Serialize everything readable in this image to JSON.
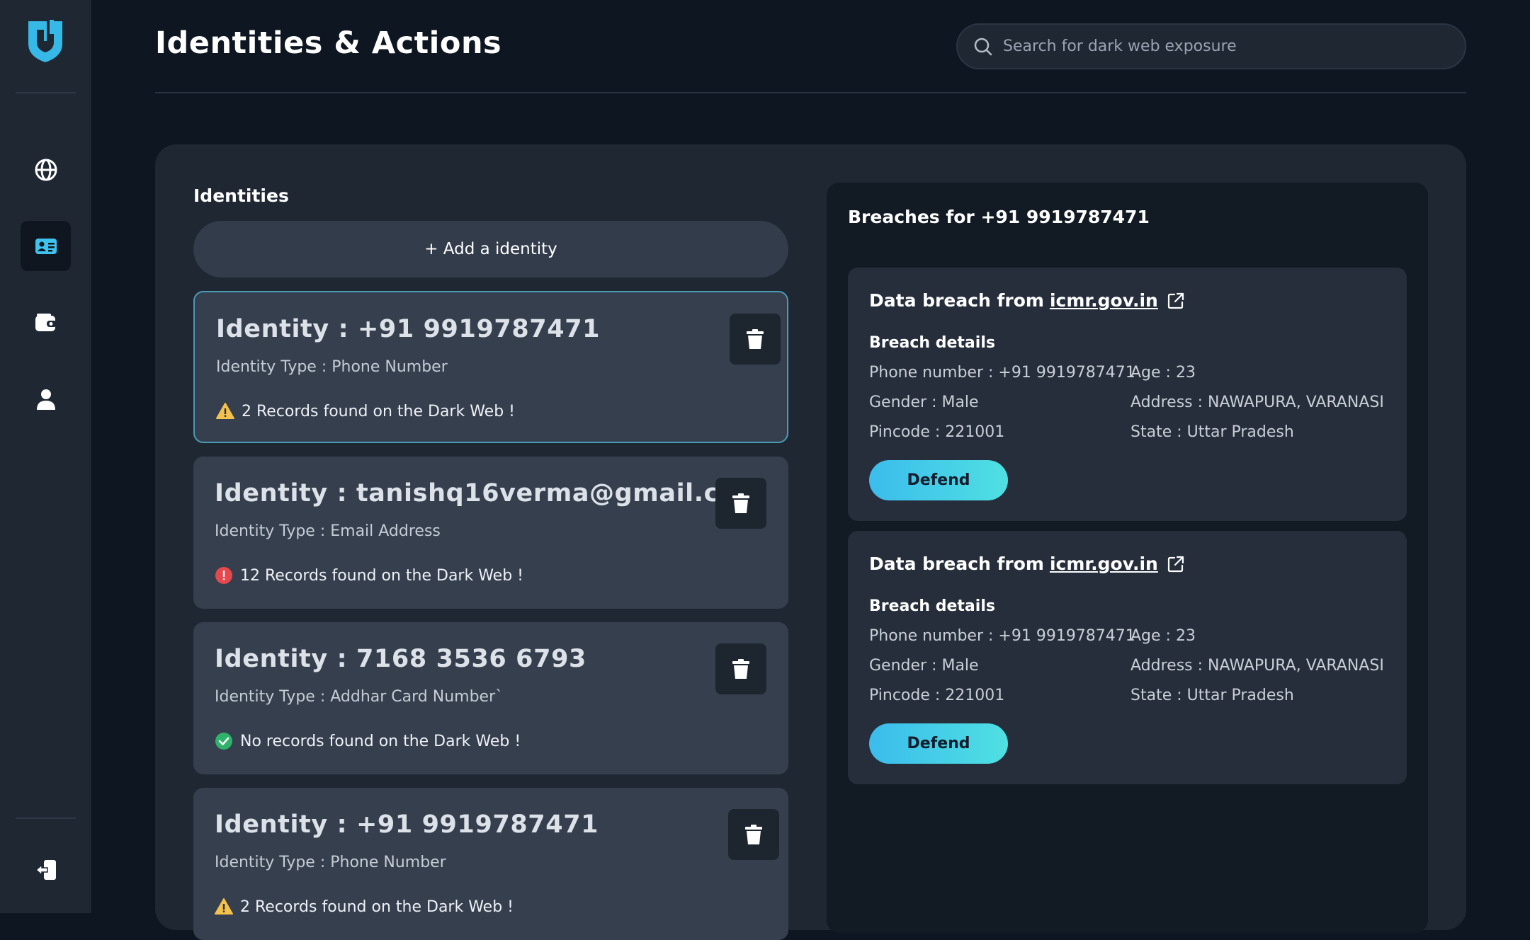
{
  "header": {
    "title": "Identities & Actions",
    "search_placeholder": "Search for dark web exposure"
  },
  "sidebar": {
    "items": [
      {
        "name": "globe-icon",
        "active": false
      },
      {
        "name": "id-card-icon",
        "active": true
      },
      {
        "name": "wallet-icon",
        "active": false
      },
      {
        "name": "user-icon",
        "active": false
      }
    ]
  },
  "identities": {
    "heading": "Identities",
    "add_label": "+ Add a identity",
    "cards": [
      {
        "title": "Identity : +91 9919787471",
        "type": "Identity Type : Phone Number",
        "status": "2 Records found on the Dark Web !",
        "level": "warning"
      },
      {
        "title": "Identity : tanishq16verma@gmail.com",
        "type": "Identity Type : Email Address",
        "status": "12 Records found on the Dark Web !",
        "level": "danger"
      },
      {
        "title": "Identity : 7168 3536 6793",
        "type": "Identity Type : Addhar Card Number`",
        "status": "No records found on the Dark Web !",
        "level": "ok"
      },
      {
        "title": "Identity : +91 9919787471",
        "type": "Identity Type : Phone Number",
        "status": "2 Records found on the Dark Web !",
        "level": "warning"
      }
    ]
  },
  "breaches": {
    "heading": "Breaches for +91 9919787471",
    "cards": [
      {
        "title_prefix": "Data breach from",
        "source": "icmr.gov.in",
        "details_label": "Breach details",
        "phone": "Phone number : +91 9919787471",
        "age": "Age : 23",
        "gender": "Gender : Male",
        "address": "Address : NAWAPURA, VARANASI",
        "pincode": "Pincode : 221001",
        "state": "State : Uttar Pradesh",
        "action": "Defend"
      },
      {
        "title_prefix": "Data breach from",
        "source": "icmr.gov.in",
        "details_label": "Breach details",
        "phone": "Phone number : +91 9919787471",
        "age": "Age : 23",
        "gender": "Gender : Male",
        "address": "Address : NAWAPURA, VARANASI",
        "pincode": "Pincode : 221001",
        "state": "State : Uttar Pradesh",
        "action": "Defend"
      }
    ]
  },
  "colors": {
    "accent": "#3bbcec",
    "warning": "#f2c14e",
    "danger": "#e5484d",
    "ok": "#2fb36b"
  }
}
